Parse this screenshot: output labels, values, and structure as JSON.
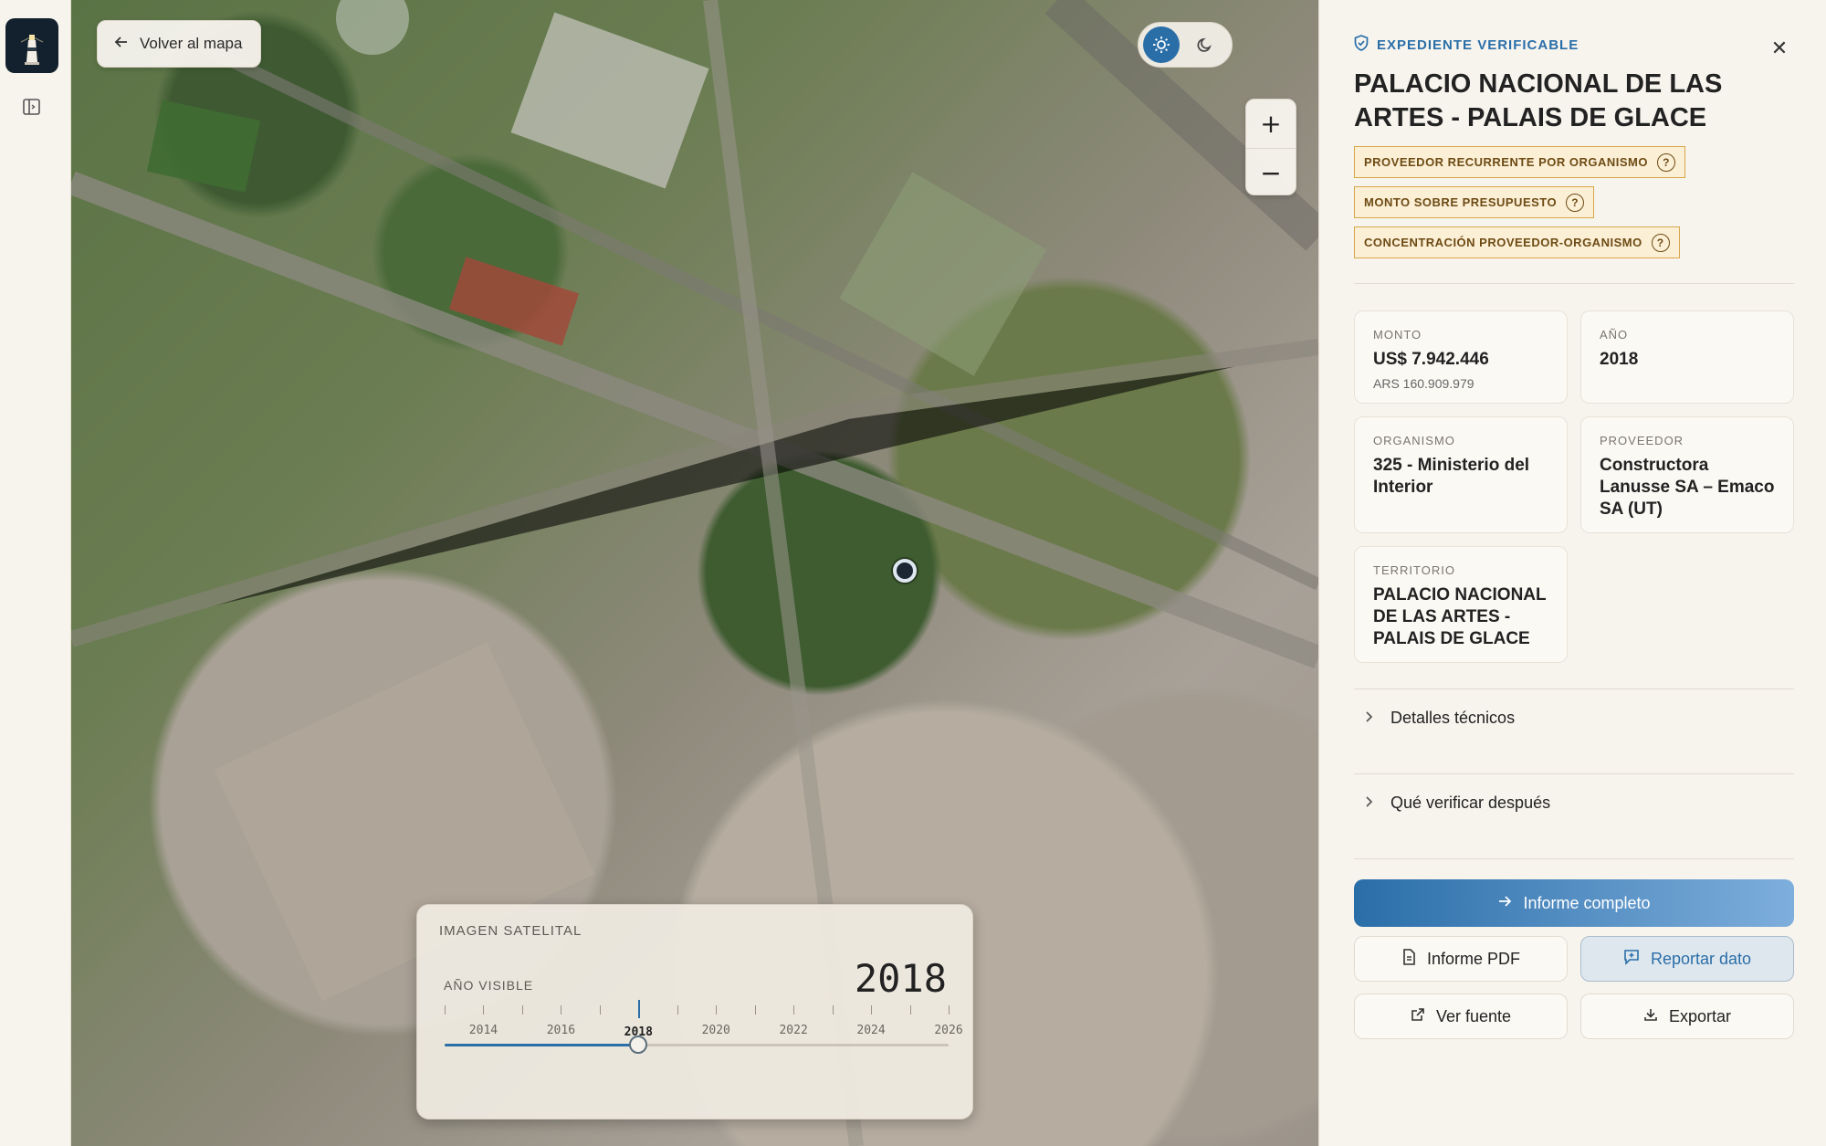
{
  "rail": {
    "logo_icon": "lighthouse-icon",
    "toggle_icon": "sidebar-toggle-icon"
  },
  "map": {
    "back_label": "Volver al mapa",
    "theme": {
      "light_icon": "sun-icon",
      "dark_icon": "moon-icon",
      "selected": "light"
    },
    "zoom_in": "+",
    "zoom_out": "−"
  },
  "timeline": {
    "title": "IMAGEN SATELITAL",
    "visible_label": "AÑO VISIBLE",
    "year": "2018",
    "min_year": 2013,
    "max_year": 2026,
    "selected_year": 2018,
    "labels": [
      "2014",
      "2016",
      "2018",
      "2020",
      "2022",
      "2024",
      "2026"
    ]
  },
  "panel": {
    "verifiable": "EXPEDIENTE VERIFICABLE",
    "title": "PALACIO NACIONAL DE LAS ARTES - PALAIS DE GLACE",
    "badges": [
      "PROVEEDOR RECURRENTE POR ORGANISMO",
      "MONTO SOBRE PRESUPUESTO",
      "CONCENTRACIÓN PROVEEDOR-ORGANISMO"
    ],
    "monto": {
      "label": "MONTO",
      "value": "US$ 7.942.446",
      "sub": "ARS 160.909.979"
    },
    "anio": {
      "label": "AÑO",
      "value": "2018"
    },
    "organismo": {
      "label": "ORGANISMO",
      "value": "325 - Ministerio del Interior"
    },
    "proveedor": {
      "label": "PROVEEDOR",
      "value": "Constructora Lanusse SA – Emaco SA (UT)"
    },
    "territorio": {
      "label": "TERRITORIO",
      "value": "PALACIO NACIONAL DE LAS ARTES - PALAIS DE GLACE"
    },
    "accordion": [
      "Detalles técnicos",
      "Qué verificar después"
    ],
    "buttons": {
      "informe_completo": "Informe completo",
      "informe_pdf": "Informe PDF",
      "reportar": "Reportar dato",
      "ver_fuente": "Ver fuente",
      "exportar": "Exportar"
    }
  },
  "colors": {
    "accent": "#2a6ea8",
    "badge_border": "#d9a64a",
    "badge_bg": "#fbefd6"
  }
}
